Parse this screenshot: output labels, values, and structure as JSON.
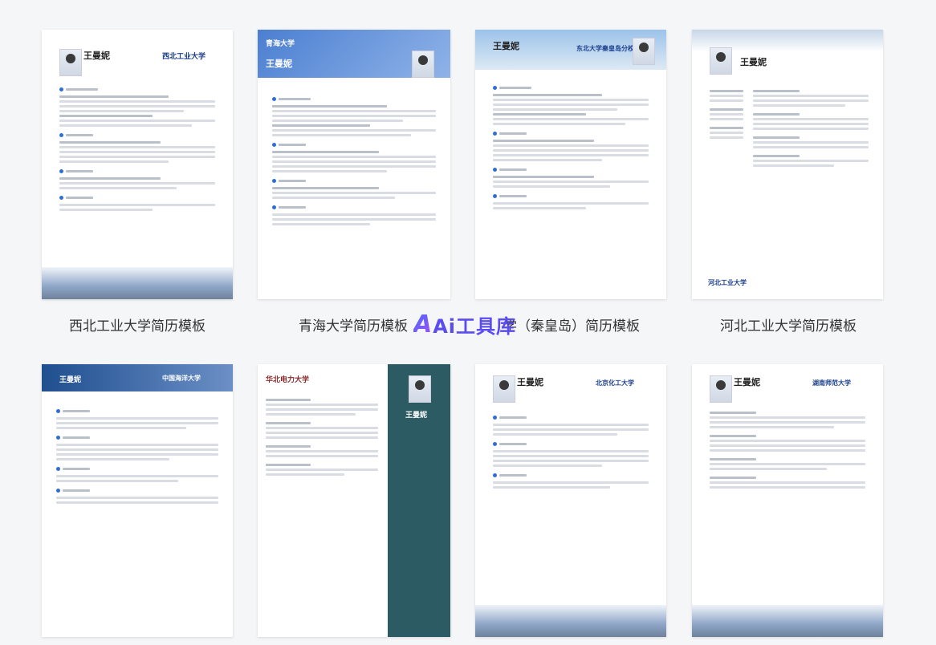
{
  "templates": [
    {
      "caption": "西北工业大学简历模板",
      "name": "王曼妮",
      "logo": "西北工业大学"
    },
    {
      "caption": "青海大学简历模板",
      "name": "王曼妮",
      "logo": "青海大学"
    },
    {
      "caption": "学（秦皇岛）简历模板",
      "name": "王曼妮",
      "logo": "东北大学秦皇岛分校"
    },
    {
      "caption": "河北工业大学简历模板",
      "name": "王曼妮",
      "logo": "河北工业大学"
    },
    {
      "caption": "",
      "name": "王曼妮",
      "logo": "中国海洋大学"
    },
    {
      "caption": "",
      "name": "王曼妮",
      "logo": "华北电力大学"
    },
    {
      "caption": "",
      "name": "王曼妮",
      "logo": "北京化工大学"
    },
    {
      "caption": "",
      "name": "王曼妮",
      "logo": "湖南师范大学"
    }
  ],
  "watermark": {
    "a": "A",
    "text": "Ai工具库"
  },
  "colors": {
    "accent": "#2d6fd6",
    "teal": "#2c5b63"
  }
}
